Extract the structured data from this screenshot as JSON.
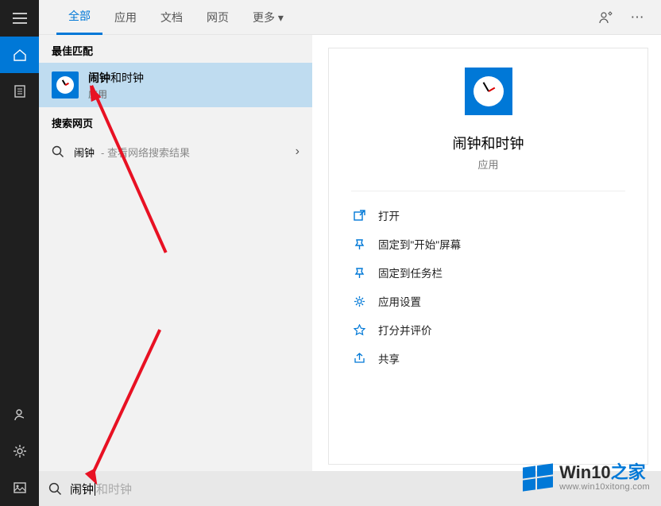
{
  "sidebar": {
    "buttons": [
      "menu",
      "home",
      "recent",
      "user",
      "settings",
      "image"
    ]
  },
  "topbar": {
    "tabs": [
      "全部",
      "应用",
      "文档",
      "网页",
      "更多 ▾"
    ]
  },
  "results": {
    "best_header": "最佳匹配",
    "best_item": {
      "title_bold": "闹钟",
      "title_rest": "和时钟",
      "sub": "应用"
    },
    "web_header": "搜索网页",
    "web_item": {
      "label": "闹钟",
      "hint": "- 查看网络搜索结果"
    }
  },
  "preview": {
    "title": "闹钟和时钟",
    "sub": "应用",
    "actions": [
      "打开",
      "固定到\"开始\"屏幕",
      "固定到任务栏",
      "应用设置",
      "打分并评价",
      "共享"
    ]
  },
  "search": {
    "typed": "闹钟",
    "ghost": "和时钟"
  },
  "watermark": {
    "main_pre": "Win10",
    "main_post": "之家",
    "sub": "www.win10xitong.com"
  }
}
